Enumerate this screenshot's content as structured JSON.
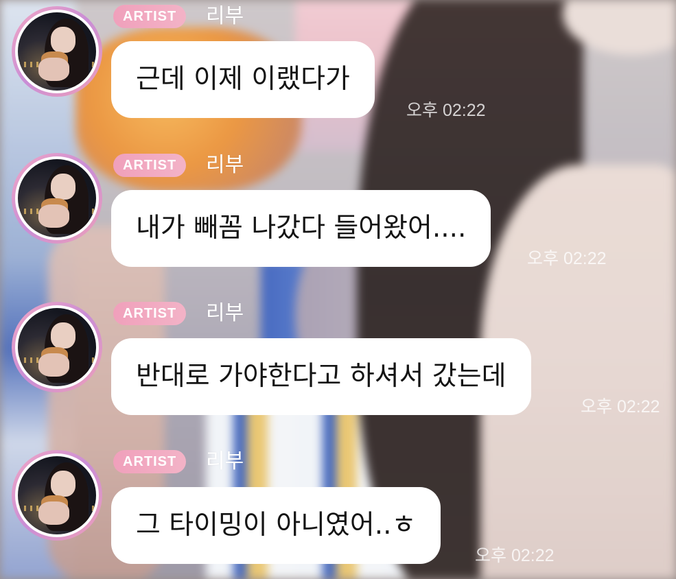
{
  "messages": [
    {
      "badge": "ARTIST",
      "sender": "리부",
      "text": "근데 이제 이랬다가",
      "time": "오후 02:22"
    },
    {
      "badge": "ARTIST",
      "sender": "리부",
      "text": "내가 빼꼼 나갔다 들어왔어....",
      "time": "오후 02:22"
    },
    {
      "badge": "ARTIST",
      "sender": "리부",
      "text": "반대로 가야한다고 하셔서 갔는데",
      "time": "오후 02:22"
    },
    {
      "badge": "ARTIST",
      "sender": "리부",
      "text": "그 타이밍이 아니였어..ㅎ",
      "time": "오후 02:22"
    }
  ],
  "colors": {
    "badge": "#f0a0bb",
    "bubble": "#ffffff",
    "avatar_ring": "#f3a7c3"
  }
}
